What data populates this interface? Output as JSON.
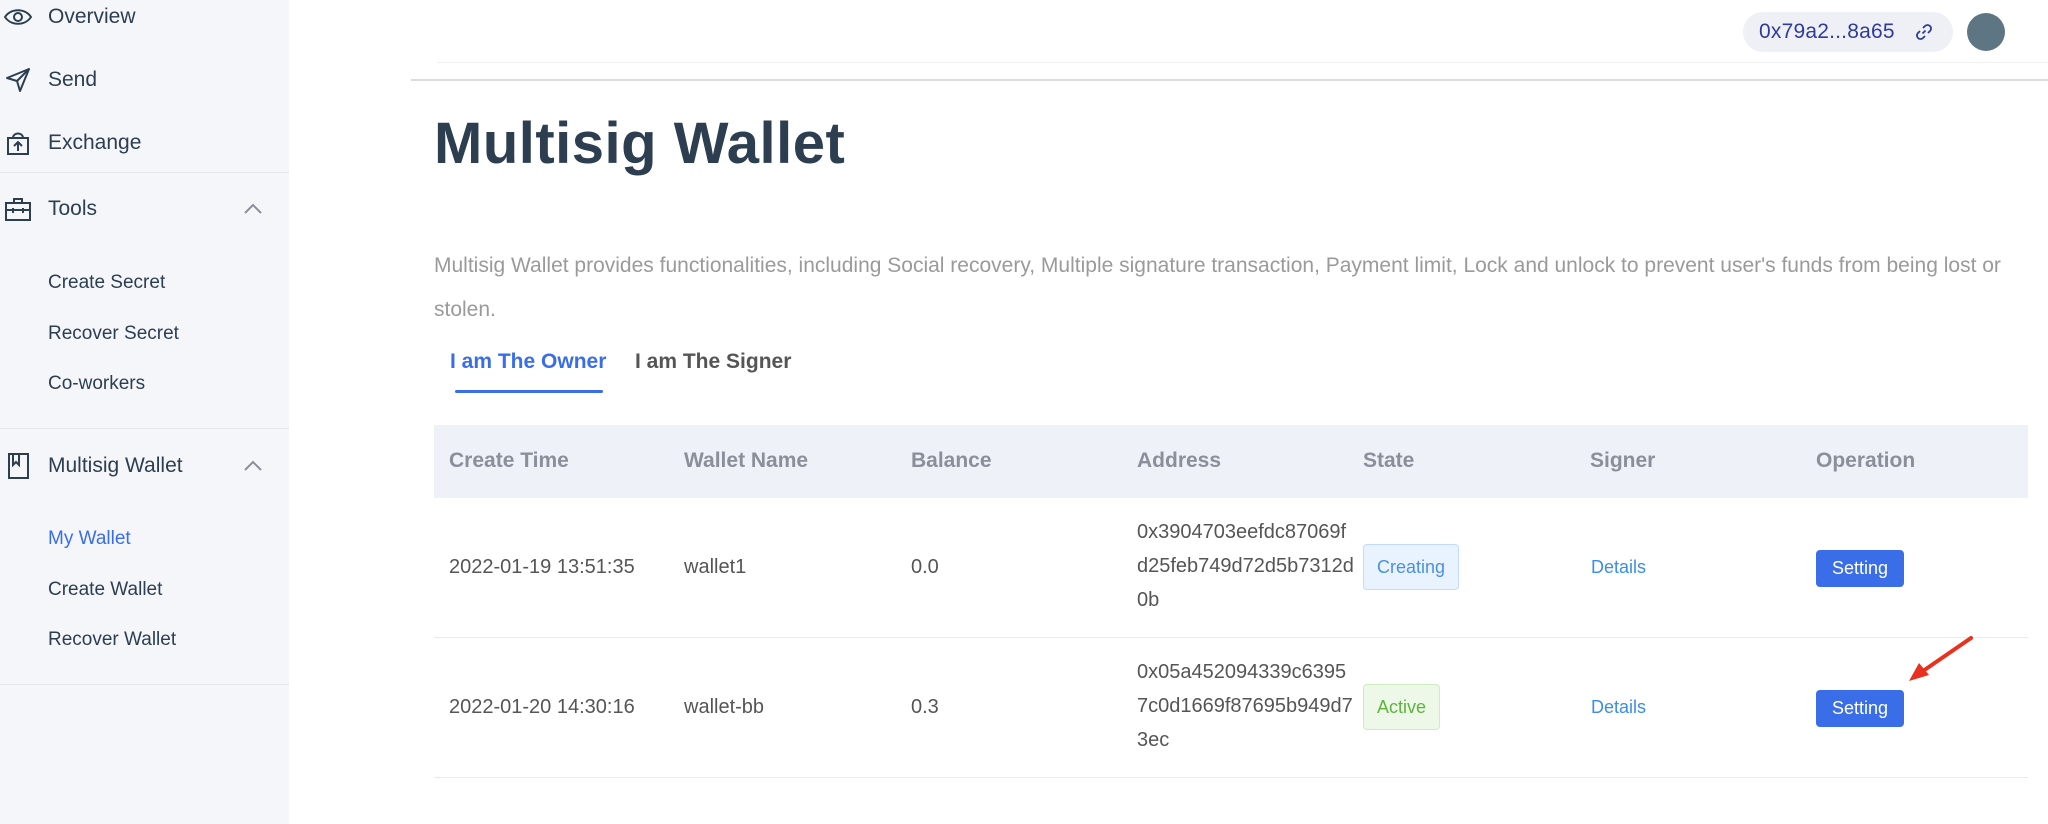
{
  "sidebar": {
    "items": [
      {
        "label": "Overview",
        "icon": "eye-icon"
      },
      {
        "label": "Send",
        "icon": "send-icon"
      },
      {
        "label": "Exchange",
        "icon": "exchange-icon"
      },
      {
        "label": "Tools",
        "icon": "toolbox-icon",
        "expanded": true
      },
      {
        "label": "Multisig Wallet",
        "icon": "book-icon",
        "expanded": true
      }
    ],
    "tools_sub": [
      "Create Secret",
      "Recover Secret",
      "Co-workers"
    ],
    "wallet_sub": [
      "My Wallet",
      "Create Wallet",
      "Recover Wallet"
    ],
    "active_sub": "My Wallet"
  },
  "header": {
    "address": "0x79a2...8a65",
    "link_icon": "link-icon",
    "avatar": "avatar"
  },
  "main": {
    "title": "Multisig Wallet",
    "description": "Multisig Wallet provides functionalities, including Social recovery, Multiple signature transaction, Payment limit, Lock and unlock to prevent user's funds from being lost or stolen.",
    "tabs": [
      {
        "label": "I am The Owner",
        "active": true
      },
      {
        "label": "I am The Signer",
        "active": false
      }
    ]
  },
  "table": {
    "headers": [
      "Create Time",
      "Wallet Name",
      "Balance",
      "Address",
      "State",
      "Signer",
      "Operation"
    ],
    "rows": [
      {
        "create_time": "2022-01-19 13:51:35",
        "wallet_name": "wallet1",
        "balance": "0.0",
        "address": "0x3904703eefdc87069fd25feb749d72d5b7312d0b",
        "state": "Creating",
        "signer": "Details",
        "operation": "Setting"
      },
      {
        "create_time": "2022-01-20 14:30:16",
        "wallet_name": "wallet-bb",
        "balance": "0.3",
        "address": "0x05a452094339c63957c0d1669f87695b949d73ec",
        "state": "Active",
        "signer": "Details",
        "operation": "Setting"
      }
    ]
  },
  "colors": {
    "accent": "#3a6ee8",
    "creating": "#4a90e2",
    "active": "#5fb33f",
    "annotation_arrow": "#e8321f"
  }
}
